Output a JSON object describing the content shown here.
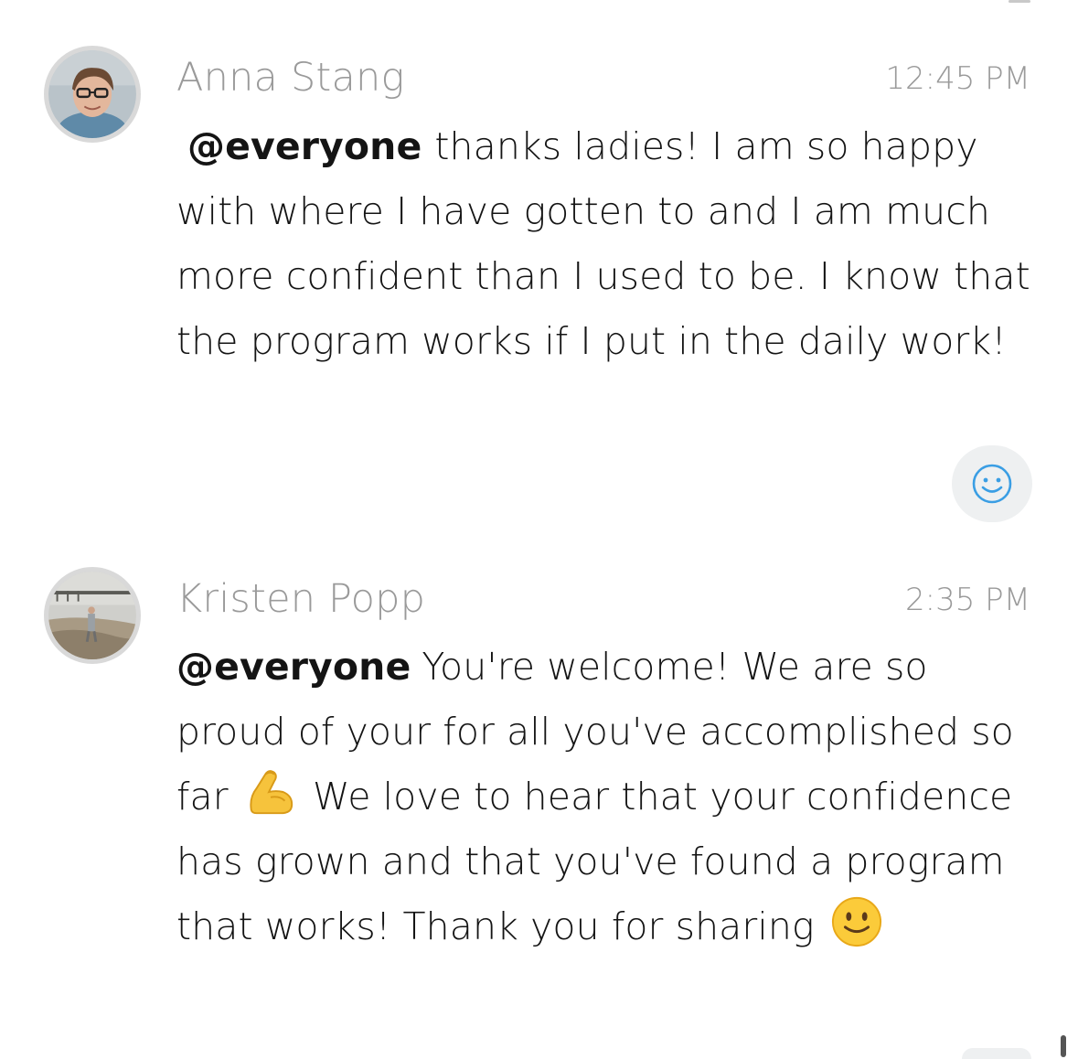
{
  "messages": [
    {
      "author": "Anna Stang",
      "time": "12:45 PM",
      "avatar_icon": "avatar-photo-woman-glasses",
      "mention": "@everyone",
      "text": "thanks ladies! I am so happy with where I have gotten to and I am much more confident than I used to be. I know that the program works if I put in the daily work!",
      "reaction_icon": "smiley-reaction-icon"
    },
    {
      "author": "Kristen Popp",
      "time": "2:35 PM",
      "avatar_icon": "avatar-photo-beach",
      "mention": "@everyone",
      "text_part1": "You're welcome! We are so proud of your for all you've accomplished so far",
      "emoji1": "flexed-biceps-emoji",
      "text_part2": "We love to hear that your confidence has grown and that you've found a program that works! Thank you for sharing",
      "emoji2": "slightly-smiling-face-emoji"
    }
  ],
  "colors": {
    "author": "#9a9a9a",
    "time": "#9a9a9a",
    "text": "#141414",
    "reaction_bg": "#eef0f1",
    "reaction_icon": "#3a9ee4"
  }
}
